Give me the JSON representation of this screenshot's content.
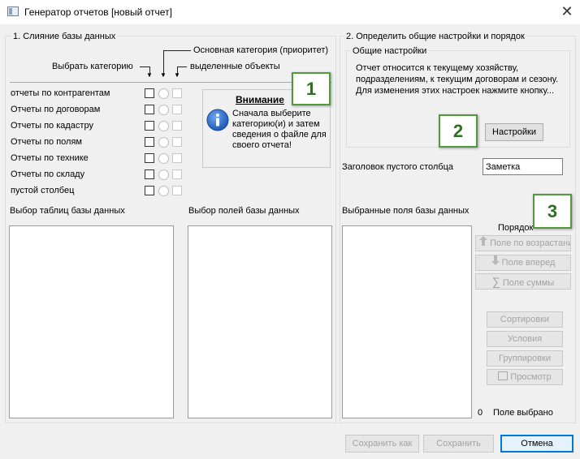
{
  "window": {
    "title": "Генератор отчетов [новый отчет]",
    "close_glyph": "✕"
  },
  "section1": {
    "title": "1. Слияние базы данных",
    "col_headers": {
      "select_category": "Выбрать категорию",
      "main_category": "Основная категория (приоритет)",
      "selected_objects": "выделенные объекты"
    },
    "categories": [
      {
        "label": "отчеты по контрагентам"
      },
      {
        "label": "Отчеты по договорам"
      },
      {
        "label": "Отчеты по кадастру"
      },
      {
        "label": "Отчеты по полям"
      },
      {
        "label": "Отчеты по технике"
      },
      {
        "label": "Отчеты по складу"
      },
      {
        "label": "пустой столбец"
      }
    ],
    "notice": {
      "title": "Внимание",
      "text": "Сначала выберите категорию(и) и затем сведения о файле для своего отчета!",
      "icon": "info-icon"
    },
    "tables_label": "Выбор таблиц базы данных",
    "fields_label": "Выбор полей базы данных"
  },
  "section2": {
    "title": "2. Определить общие настройки и порядок",
    "general": {
      "title": "Общие настройки",
      "text": "Отчет относится к текущему хозяйству, подразделениям, к текущим договорам и сезону. Для изменения этих настроек нажмите кнопку...",
      "settings_button": "Настройки"
    },
    "empty_column_label": "Заголовок пустого столбца",
    "empty_column_value": "Заметка",
    "selected_fields_label": "Выбранные поля базы данных",
    "order_label": "Порядок",
    "order_buttons": [
      {
        "label": "Поле по возрастанию",
        "icon": "arrow-up-icon"
      },
      {
        "label": "Поле вперед",
        "icon": "arrow-down-icon"
      },
      {
        "label": "Поле суммы",
        "icon": "sigma-icon"
      }
    ],
    "action_buttons": [
      {
        "label": "Сортировки"
      },
      {
        "label": "Условия"
      },
      {
        "label": "Группировки"
      },
      {
        "label": "Просмотр",
        "icon": "preview-icon"
      }
    ],
    "selected_count": "0",
    "selected_count_label": "Поле выбрано"
  },
  "badges": [
    "1",
    "2",
    "3"
  ],
  "footer": {
    "save_as": "Сохранить как",
    "save": "Сохранить",
    "cancel": "Отмена"
  },
  "colors": {
    "badge_border": "#4f9a3a",
    "badge_text": "#2f6e27",
    "cancel_border": "#0078d7"
  }
}
